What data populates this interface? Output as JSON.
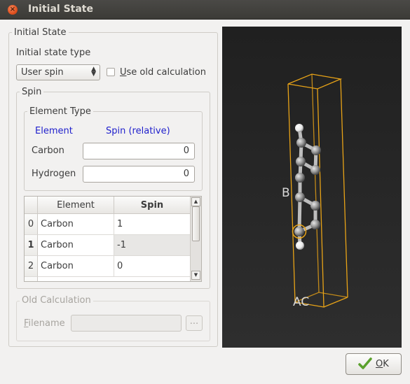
{
  "window": {
    "title": "Initial State"
  },
  "initial_state": {
    "group_title": "Initial State",
    "type_label": "Initial state type",
    "type_value": "User spin",
    "use_old_calc_u": "U",
    "use_old_calc_rest": "se old calculation",
    "use_old_calc_checked": false
  },
  "spin": {
    "group_title": "Spin",
    "element_type": {
      "group_title": "Element Type",
      "col_element": "Element",
      "col_spin": "Spin (relative)",
      "header_color": "#1f1fcc",
      "rows": [
        {
          "label": "Carbon",
          "value": "0"
        },
        {
          "label": "Hydrogen",
          "value": "0"
        }
      ]
    },
    "table": {
      "headers": [
        "Element",
        "Spin"
      ],
      "rows": [
        {
          "index": "0",
          "element": "Carbon",
          "spin": "1"
        },
        {
          "index": "1",
          "element": "Carbon",
          "spin": "-1"
        },
        {
          "index": "2",
          "element": "Carbon",
          "spin": "0"
        }
      ]
    }
  },
  "old_calculation": {
    "group_title": "Old Calculation",
    "filename_u": "F",
    "filename_rest": "ilename",
    "filename_value": "",
    "browse_label": "..."
  },
  "viewer": {
    "label_b": "B",
    "label_ac": "AC",
    "cell_color": "#e8a317",
    "atom_carbon_color": "#9a9a9a",
    "atom_hydrogen_color": "#f2f2f2"
  },
  "footer": {
    "ok_u": "O",
    "ok_rest": "K"
  }
}
